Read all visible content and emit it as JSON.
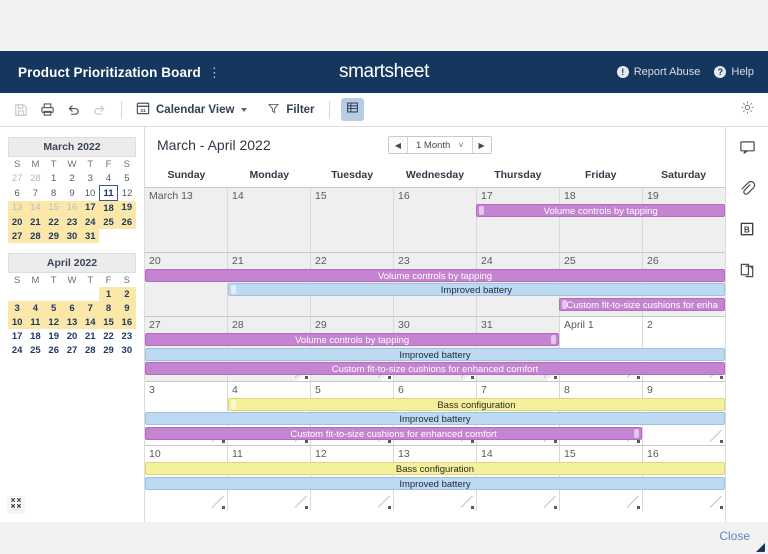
{
  "topbar": {
    "title": "Product Prioritization Board",
    "kebab": "⋮",
    "logo": "smartsheet",
    "report_abuse": "Report Abuse",
    "report_abuse_icon": "exclamation-circle-icon",
    "help": "Help",
    "help_icon": "question-circle-icon",
    "bg_color": "#15375e"
  },
  "toolbar": {
    "save_icon": "save-icon",
    "print_icon": "print-icon",
    "undo_icon": "undo-icon",
    "redo_icon": "redo-icon",
    "view_label": "Calendar View",
    "view_icon": "calendar-icon",
    "filter_label": "Filter",
    "filter_icon": "filter-icon",
    "grid_toggle_icon": "grid-view-icon",
    "settings_icon": "gear-icon"
  },
  "minicalendars": [
    {
      "title": "March 2022",
      "weekday_initials": [
        "S",
        "M",
        "T",
        "W",
        "T",
        "F",
        "S"
      ],
      "weeks": [
        [
          {
            "d": "27",
            "s": "mut"
          },
          {
            "d": "28",
            "s": "mut"
          },
          {
            "d": "1",
            "s": "plain"
          },
          {
            "d": "2",
            "s": "plain"
          },
          {
            "d": "3",
            "s": "plain"
          },
          {
            "d": "4",
            "s": "plain"
          },
          {
            "d": "5",
            "s": "plain"
          }
        ],
        [
          {
            "d": "6",
            "s": "plain"
          },
          {
            "d": "7",
            "s": "plain"
          },
          {
            "d": "8",
            "s": "plain"
          },
          {
            "d": "9",
            "s": "plain"
          },
          {
            "d": "10",
            "s": "plain"
          },
          {
            "d": "11",
            "s": "today"
          },
          {
            "d": "12",
            "s": "plain"
          }
        ],
        [
          {
            "d": "13",
            "s": "hl mut"
          },
          {
            "d": "14",
            "s": "hl mut"
          },
          {
            "d": "15",
            "s": "hl mut"
          },
          {
            "d": "16",
            "s": "hl mut"
          },
          {
            "d": "17",
            "s": "hl"
          },
          {
            "d": "18",
            "s": "hl"
          },
          {
            "d": "19",
            "s": "hl"
          }
        ],
        [
          {
            "d": "20",
            "s": "hl"
          },
          {
            "d": "21",
            "s": "hl"
          },
          {
            "d": "22",
            "s": "hl"
          },
          {
            "d": "23",
            "s": "hl"
          },
          {
            "d": "24",
            "s": "hl"
          },
          {
            "d": "25",
            "s": "hl"
          },
          {
            "d": "26",
            "s": "hl"
          }
        ],
        [
          {
            "d": "27",
            "s": "hl"
          },
          {
            "d": "28",
            "s": "hl"
          },
          {
            "d": "29",
            "s": "hl"
          },
          {
            "d": "30",
            "s": "hl"
          },
          {
            "d": "31",
            "s": "hl"
          },
          {
            "d": "",
            "s": "empty"
          },
          {
            "d": "",
            "s": "empty"
          }
        ]
      ]
    },
    {
      "title": "April 2022",
      "weekday_initials": [
        "S",
        "M",
        "T",
        "W",
        "T",
        "F",
        "S"
      ],
      "weeks": [
        [
          {
            "d": "",
            "s": "empty"
          },
          {
            "d": "",
            "s": "empty"
          },
          {
            "d": "",
            "s": "empty"
          },
          {
            "d": "",
            "s": "empty"
          },
          {
            "d": "",
            "s": "empty"
          },
          {
            "d": "1",
            "s": "hl"
          },
          {
            "d": "2",
            "s": "hl"
          }
        ],
        [
          {
            "d": "3",
            "s": "hl"
          },
          {
            "d": "4",
            "s": "hl"
          },
          {
            "d": "5",
            "s": "hl"
          },
          {
            "d": "6",
            "s": "hl"
          },
          {
            "d": "7",
            "s": "hl"
          },
          {
            "d": "8",
            "s": "hl"
          },
          {
            "d": "9",
            "s": "hl"
          }
        ],
        [
          {
            "d": "10",
            "s": "hl"
          },
          {
            "d": "11",
            "s": "hl"
          },
          {
            "d": "12",
            "s": "hl"
          },
          {
            "d": "13",
            "s": "hl"
          },
          {
            "d": "14",
            "s": "hl"
          },
          {
            "d": "15",
            "s": "hl"
          },
          {
            "d": "16",
            "s": "hl"
          }
        ],
        [
          {
            "d": "17",
            "s": ""
          },
          {
            "d": "18",
            "s": ""
          },
          {
            "d": "19",
            "s": ""
          },
          {
            "d": "20",
            "s": ""
          },
          {
            "d": "21",
            "s": ""
          },
          {
            "d": "22",
            "s": ""
          },
          {
            "d": "23",
            "s": ""
          }
        ],
        [
          {
            "d": "24",
            "s": ""
          },
          {
            "d": "25",
            "s": ""
          },
          {
            "d": "26",
            "s": ""
          },
          {
            "d": "27",
            "s": ""
          },
          {
            "d": "28",
            "s": ""
          },
          {
            "d": "29",
            "s": ""
          },
          {
            "d": "30",
            "s": ""
          }
        ]
      ]
    }
  ],
  "expand_icon": "expand-icon",
  "calendar": {
    "range_title": "March - April 2022",
    "nav": {
      "prev_icon": "prev-arrow-icon",
      "next_icon": "next-arrow-icon",
      "span_label": "1 Month",
      "span_caret": "˅"
    },
    "weekdays": [
      "Sunday",
      "Monday",
      "Tuesday",
      "Wednesday",
      "Thursday",
      "Friday",
      "Saturday"
    ],
    "weeks": [
      {
        "days": [
          {
            "label": "March 13",
            "month": "march"
          },
          {
            "label": "14",
            "month": "march"
          },
          {
            "label": "15",
            "month": "march"
          },
          {
            "label": "16",
            "month": "march"
          },
          {
            "label": "17",
            "month": "march"
          },
          {
            "label": "18",
            "month": "march"
          },
          {
            "label": "19",
            "month": "march"
          }
        ],
        "corners": [
          false,
          false,
          false,
          false,
          false,
          false,
          false
        ],
        "events": [
          {
            "title": "Volume controls by tapping",
            "color": "purple",
            "start": 4,
            "span": 3,
            "row": 0,
            "cap_left": true,
            "cap_right": false
          }
        ]
      },
      {
        "days": [
          {
            "label": "20",
            "month": "march"
          },
          {
            "label": "21",
            "month": "march"
          },
          {
            "label": "22",
            "month": "march"
          },
          {
            "label": "23",
            "month": "march"
          },
          {
            "label": "24",
            "month": "march"
          },
          {
            "label": "25",
            "month": "march"
          },
          {
            "label": "26",
            "month": "march"
          }
        ],
        "corners": [
          false,
          false,
          false,
          false,
          false,
          false,
          false
        ],
        "events": [
          {
            "title": "Volume controls by tapping",
            "color": "purple",
            "start": 0,
            "span": 7,
            "row": 0,
            "cap_left": false,
            "cap_right": false
          },
          {
            "title": "Improved battery",
            "color": "blue",
            "start": 1,
            "span": 6,
            "row": 1,
            "cap_left": true,
            "cap_right": false
          },
          {
            "title": "Custom fit-to-size cushions for enha",
            "color": "purple",
            "start": 5,
            "span": 2,
            "row": 2,
            "cap_left": true,
            "cap_right": false
          }
        ]
      },
      {
        "days": [
          {
            "label": "27",
            "month": "march"
          },
          {
            "label": "28",
            "month": "march"
          },
          {
            "label": "29",
            "month": "march"
          },
          {
            "label": "30",
            "month": "march"
          },
          {
            "label": "31",
            "month": "march"
          },
          {
            "label": "April 1",
            "month": "april"
          },
          {
            "label": "2",
            "month": "april"
          }
        ],
        "corners": [
          false,
          true,
          true,
          true,
          true,
          true,
          true
        ],
        "events": [
          {
            "title": "Volume controls by tapping",
            "color": "purple",
            "start": 0,
            "span": 5,
            "row": 0,
            "cap_left": false,
            "cap_right": true
          },
          {
            "title": "Improved battery",
            "color": "blue",
            "start": 0,
            "span": 7,
            "row": 1,
            "cap_left": false,
            "cap_right": false
          },
          {
            "title": "Custom fit-to-size cushions for enhanced comfort",
            "color": "purple",
            "start": 0,
            "span": 7,
            "row": 2,
            "cap_left": false,
            "cap_right": false
          }
        ]
      },
      {
        "days": [
          {
            "label": "3",
            "month": "april"
          },
          {
            "label": "4",
            "month": "april"
          },
          {
            "label": "5",
            "month": "april"
          },
          {
            "label": "6",
            "month": "april"
          },
          {
            "label": "7",
            "month": "april"
          },
          {
            "label": "8",
            "month": "april"
          },
          {
            "label": "9",
            "month": "april"
          }
        ],
        "corners": [
          true,
          true,
          true,
          true,
          true,
          true,
          true
        ],
        "events": [
          {
            "title": "Bass configuration",
            "color": "yellow",
            "start": 1,
            "span": 6,
            "row": 0,
            "cap_left": true,
            "cap_right": false
          },
          {
            "title": "Improved battery",
            "color": "blue",
            "start": 0,
            "span": 7,
            "row": 1,
            "cap_left": false,
            "cap_right": false
          },
          {
            "title": "Custom fit-to-size cushions for enhanced comfort",
            "color": "purple",
            "start": 0,
            "span": 6,
            "row": 2,
            "cap_left": false,
            "cap_right": true
          }
        ]
      },
      {
        "days": [
          {
            "label": "10",
            "month": "april"
          },
          {
            "label": "11",
            "month": "april"
          },
          {
            "label": "12",
            "month": "april"
          },
          {
            "label": "13",
            "month": "april"
          },
          {
            "label": "14",
            "month": "april"
          },
          {
            "label": "15",
            "month": "april"
          },
          {
            "label": "16",
            "month": "april"
          }
        ],
        "corners": [
          true,
          true,
          true,
          true,
          true,
          true,
          true
        ],
        "events": [
          {
            "title": "Bass configuration",
            "color": "yellow",
            "start": 0,
            "span": 7,
            "row": 0,
            "cap_left": false,
            "cap_right": false
          },
          {
            "title": "Improved battery",
            "color": "blue",
            "start": 0,
            "span": 7,
            "row": 1,
            "cap_left": false,
            "cap_right": false
          }
        ]
      }
    ]
  },
  "rail": [
    {
      "name": "conversations-icon"
    },
    {
      "name": "attachments-icon"
    },
    {
      "name": "proofs-icon"
    },
    {
      "name": "update-requests-icon"
    }
  ],
  "footer": {
    "close_label": "Close"
  },
  "colors": {
    "purple": "#c584d1",
    "blue": "#bedaf2",
    "yellow": "#f5f09a",
    "header_blue": "#15375e",
    "highlight_yellow": "#fbe8a9",
    "link_blue": "#5b87c7"
  }
}
